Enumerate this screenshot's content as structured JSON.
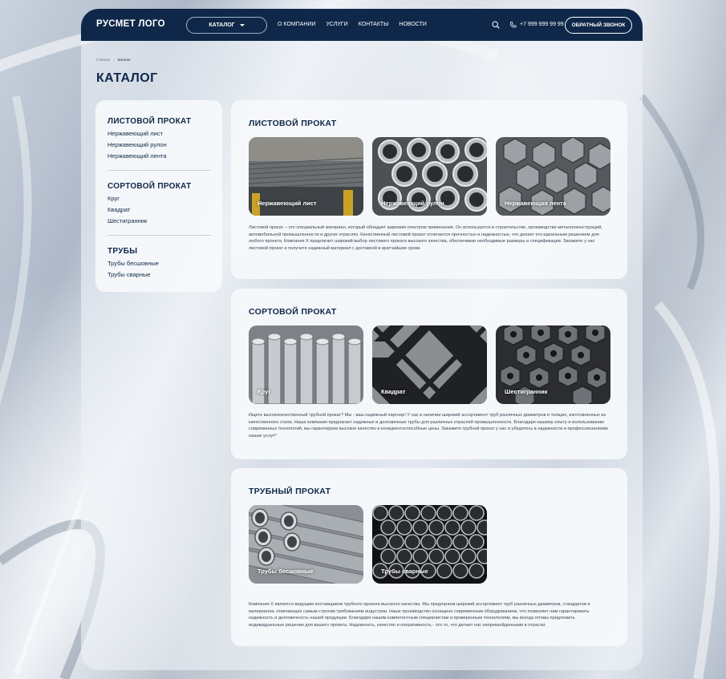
{
  "header": {
    "logo": "РУСМЕТ ЛОГО",
    "catalog_button": "КАТАЛОГ",
    "nav": [
      "О КОМПАНИИ",
      "УСЛУГИ",
      "КОНТАКТЫ",
      "НОВОСТИ"
    ],
    "phone": "+7 999 999 99 99",
    "callback_button": "ОБРАТНЫЙ ЗВОНОК",
    "icons": [
      "search-icon",
      "phone-icon",
      "chevron-down-icon"
    ]
  },
  "breadcrumbs": [
    "Главная",
    "-",
    "Каталог"
  ],
  "page_title": "КАТАЛОГ",
  "sidebar": {
    "groups": [
      {
        "title": "ЛИСТОВОЙ ПРОКАТ",
        "items": [
          "Нержавеющий лист",
          "Нержавеющий рулон",
          "Нержавеющий лента"
        ]
      },
      {
        "title": "СОРТОВОЙ ПРОКАТ",
        "items": [
          "Круг",
          "Квадрат",
          "Шестигранник"
        ]
      },
      {
        "title": "ТРУБЫ",
        "items": [
          "Трубы бесшовные",
          "Трубы сварные"
        ]
      }
    ]
  },
  "sections": [
    {
      "title": "ЛИСТОВОЙ ПРОКАТ",
      "cards": [
        "Нержавеющий лист",
        "Нержавеющий рулон",
        "Нержавеющая лента"
      ],
      "description": "Листовой прокат – это специальный материал, который обладает широким спектром применения. Он используется в строительстве, производстве металлоконструкций, автомобильной промышленности и других отраслях. Качественный листовой прокат отличается прочностью и надежностью, что делает его идеальным решением для любого проекта. Компания X предлагает широкий выбор листового проката высокого качества, обеспечивая необходимые размеры и спецификации. Закажите у нас листовой прокат и получите надежный материал с доставкой в кратчайшие сроки."
    },
    {
      "title": "СОРТОВОЙ ПРОКАТ",
      "cards": [
        "Круг",
        "Квадрат",
        "Шестигранник"
      ],
      "description": "Ищете высококачественный трубной прокат? Мы - ваш надежный партнер! У нас в наличии широкий ассортимент труб различных диаметров и толщин, изготовленных из качественного стали. Наша компания предлагает надежные и долговечные трубы для различных отраслей промышленности. Благодаря нашему опыту и использованию современных технологий, мы гарантируем высокое качество и конкурентоспособные цены. Закажите трубной прокат у нас и убедитесь в надежности и профессионализме наших услуг!\""
    },
    {
      "title": "ТРУБНЫЙ ПРОКАТ",
      "cards": [
        "Трубы бесшовные",
        "Трубы сварные"
      ],
      "description": "Компания X является ведущим поставщиком трубного проката высокого качества. Мы предлагаем широкий ассортимент труб различных диаметров, стандартов и материалов, отвечающих самым строгим требованиям индустрии. Наше производство оснащено современным оборудованием, что позволяет нам гарантировать надежность и долговечность нашей продукции. Благодаря нашим компетентным специалистам и проверенным технологиям, мы всегда готовы предложить индивидуальные решения для вашего проекта. Надежность, качество и оперативность - это то, что делает нас непревзойденными в отрасли."
    }
  ],
  "colors": {
    "primary": "#0f2849",
    "panel": "#f6f8fb",
    "text": "#3a4656"
  }
}
